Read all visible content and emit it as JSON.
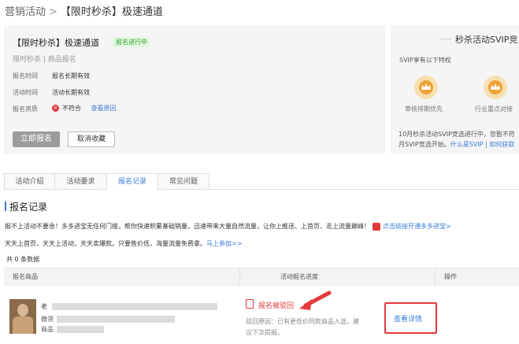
{
  "breadcrumb": {
    "parent": "营销活动",
    "separator": ">",
    "current": "【限时秒杀】极速通道"
  },
  "activity": {
    "title": "【限时秒杀】极速通道",
    "badge": "报名进行中",
    "subtitle": "限时秒杀 | 商品报名",
    "rows": [
      {
        "label": "报名时间",
        "value": "报名长期有效"
      },
      {
        "label": "活动时间",
        "value": "活动长期有效"
      },
      {
        "label": "报名资质",
        "value": "不符合",
        "link": "查看原因"
      }
    ],
    "error_glyph": "×",
    "primary_button": "立即报名",
    "secondary_button": "取消收藏"
  },
  "svip": {
    "title": "秒杀活动SVIP竞",
    "subtitle": "SVIP享有以下特权",
    "features": [
      "审核排期优先",
      "行业重点对接"
    ],
    "note_line1": "10月秒杀活动SVIP竞选进行中，您暂不符",
    "note_line2_text": "月SVIP竞选开始。",
    "note_line2_link": "什么是SVIP | 如何获取"
  },
  "tabs": [
    {
      "label": "活动介绍",
      "active": false
    },
    {
      "label": "活动要求",
      "active": false
    },
    {
      "label": "报名记录",
      "active": true
    },
    {
      "label": "常见问题",
      "active": false
    }
  ],
  "section": {
    "title": "报名记录",
    "promo_line1": "报不上活动不要急！多多进宝无任何门槛，帮你快速积累基础销量，迅速带来大量自然流量，让你上推送、上首页，走上流量巅峰！",
    "promo_line1_link": "点击链接开通多多进宝>",
    "promo_line2": "天天上首页，天天上活动，天天卖爆款。只要售价低，海量流量免费拿。",
    "promo_line2_link": "马上参加>>",
    "count_text": "共 0 条数据"
  },
  "table": {
    "headers": [
      "报名商品",
      "活动报名进度",
      "操作"
    ],
    "rows": [
      {
        "product_name": "老",
        "product_meta_1": "微领",
        "product_meta_2": "商品",
        "status": "报名被驳回",
        "reason_line1": "驳回原因：已有更低价同款商品入选，建",
        "reason_line2": "议下次提报。",
        "action": "查看详情"
      }
    ]
  },
  "colors": {
    "accent": "#3a7bd5",
    "danger": "#e4393c",
    "success": "#2ea12e"
  }
}
